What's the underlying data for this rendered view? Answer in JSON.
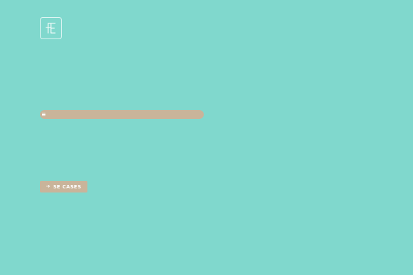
{
  "brand": {
    "logo_icon": "fe-monogram-icon"
  },
  "menu": {
    "icon": "hamburger-menu-icon"
  },
  "cta": {
    "icon": "arrow-right-icon",
    "label": "SE CASES"
  },
  "colors": {
    "background": "#80d8cd",
    "accent": "#c9b49a",
    "foreground": "#ffffff"
  }
}
